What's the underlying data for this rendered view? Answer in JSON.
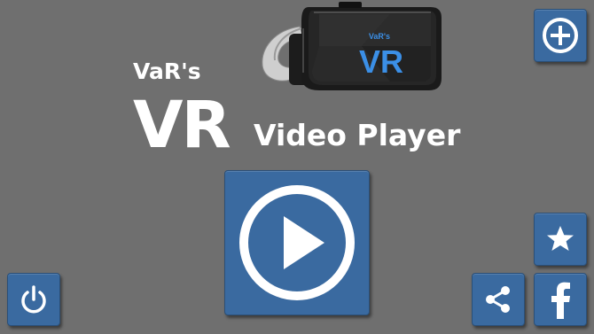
{
  "app": {
    "brand": "VaR's",
    "title_big": "VR",
    "title_sub": "Video Player"
  },
  "headset": {
    "brand_small": "VaR's",
    "brand_big": "VR"
  },
  "buttons": {
    "add": "plus-circle-icon",
    "play": "play-circle-icon",
    "power": "power-icon",
    "favorite": "star-icon",
    "share": "share-icon",
    "facebook": "facebook-icon"
  },
  "colors": {
    "background": "#6f6f6f",
    "tile": "#3a6aa0",
    "icon": "#ffffff",
    "headset_text": "#3b8fe6"
  }
}
